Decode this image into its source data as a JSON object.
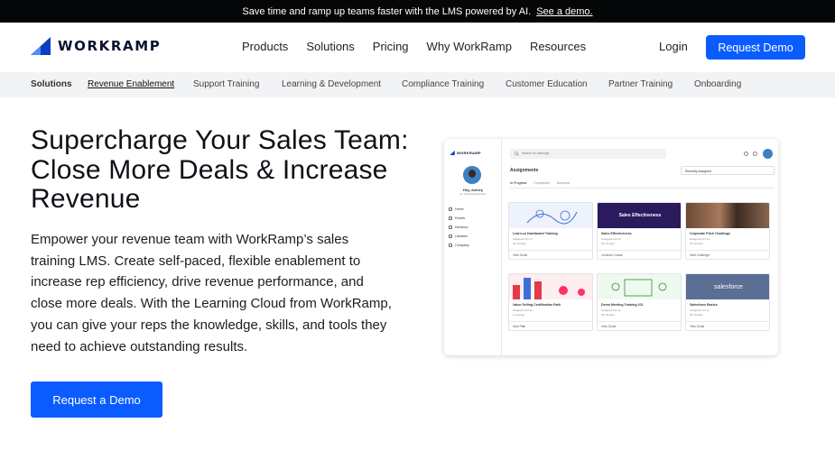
{
  "announcement": {
    "text": "Save time and ramp up teams faster with the LMS powered by AI.",
    "link": "See a demo."
  },
  "nav": {
    "brand": "WORKRAMP",
    "links": [
      "Products",
      "Solutions",
      "Pricing",
      "Why WorkRamp",
      "Resources"
    ],
    "login": "Login",
    "cta": "Request Demo"
  },
  "subnav": {
    "title": "Solutions",
    "items": [
      "Revenue Enablement",
      "Support Training",
      "Learning & Development",
      "Compliance Training",
      "Customer Education",
      "Partner Training",
      "Onboarding"
    ],
    "active": "Revenue Enablement"
  },
  "hero": {
    "title": "Supercharge Your Sales Team: Close More Deals & Increase Revenue",
    "body": "Empower your revenue team with WorkRamp’s sales training LMS. Create self-paced, flexible enablement to increase rep efficiency, drive revenue performance, and close more deals. With the Learning Cloud from WorkRamp, you can give your reps the knowledge, skills, and tools they need to achieve outstanding results.",
    "cta": "Request a Demo"
  },
  "mock": {
    "brand": "WORKRAMP",
    "search_placeholder": "Search for trainings",
    "greeting": "Hey, Ashley",
    "role": "Sr. Account Executive",
    "menu": [
      "Home",
      "Events",
      "Directory",
      "Libraries",
      "Company"
    ],
    "heading": "Assignments",
    "sort": "Recently Assigned",
    "tabs": [
      "In Progress",
      "Completed",
      "Archived"
    ],
    "cards": [
      {
        "title": "Learn.co Dashboard Training",
        "meta1": "Assigned Oct 17",
        "meta2": "30 minutes",
        "action": "View Guide",
        "image": "illustration-blue"
      },
      {
        "title": "Sales Effectiveness",
        "meta1": "Assigned Oct 11",
        "meta2": "30 minutes",
        "action": "Continue Course",
        "image_text": "Sales Effectiveness"
      },
      {
        "title": "Corporate Pitch Challenge",
        "meta1": "Assigned Oct 21",
        "meta2": "20 minutes",
        "action": "Start Challenge",
        "image": "photo-meeting"
      },
      {
        "title": "Value Selling Certification Path",
        "meta1": "Assigned Oct 11",
        "meta2": "2 courses",
        "action": "Start Path",
        "image": "illustration-chart"
      },
      {
        "title": "Demo Meeting Training 101",
        "meta1": "Assigned Oct 11",
        "meta2": "30 minutes",
        "action": "View Guide",
        "image": "illustration-green"
      },
      {
        "title": "Salesforce Basics",
        "meta1": "Assigned Oct 11",
        "meta2": "30 minutes",
        "action": "View Guide",
        "image_text": "salesforce"
      }
    ]
  },
  "colors": {
    "primary": "#0a5cff",
    "announce_bg": "#050607",
    "subnav_bg": "#f2f3f5"
  }
}
